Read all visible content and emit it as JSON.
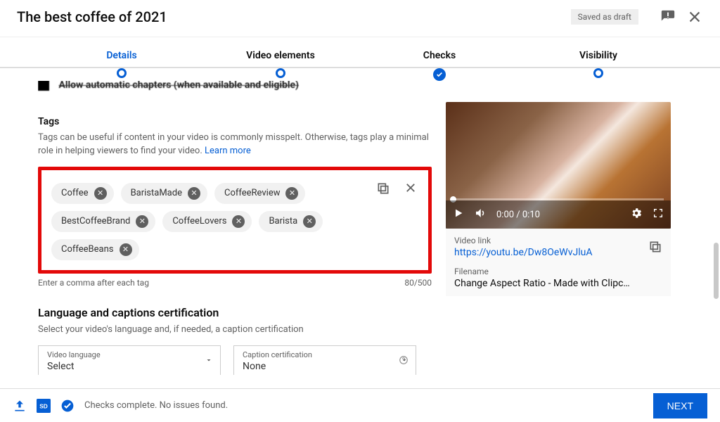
{
  "header": {
    "title": "The best coffee of 2021",
    "draft_status": "Saved as draft"
  },
  "stepper": {
    "items": [
      {
        "label": "Details",
        "state": "active"
      },
      {
        "label": "Video elements",
        "state": "pending"
      },
      {
        "label": "Checks",
        "state": "done"
      },
      {
        "label": "Visibility",
        "state": "pending"
      }
    ]
  },
  "truncated_prev": "Allow automatic chapters (when available and eligible)",
  "tags": {
    "heading": "Tags",
    "desc_a": "Tags can be useful if content in your video is commonly misspelt. Otherwise, tags play a minimal role in helping viewers to find your video. ",
    "learn_more": "Learn more",
    "chips": [
      "Coffee",
      "BaristaMade",
      "CoffeeReview",
      "BestCoffeeBrand",
      "CoffeeLovers",
      "Barista",
      "CoffeeBeans"
    ],
    "hint": "Enter a comma after each tag",
    "counter": "80/500"
  },
  "lang": {
    "heading": "Language and captions certification",
    "desc": "Select your video's language and, if needed, a caption certification",
    "sel1_label": "Video language",
    "sel1_value": "Select",
    "sel2_label": "Caption certification",
    "sel2_value": "None"
  },
  "preview": {
    "time": "0:00 / 0:10",
    "link_label": "Video link",
    "link_url": "https://youtu.be/Dw8OeWvJluA",
    "fn_label": "Filename",
    "fn_value": "Change Aspect Ratio - Made with Clipc…"
  },
  "footer": {
    "status": "Checks complete. No issues found.",
    "next": "NEXT"
  }
}
